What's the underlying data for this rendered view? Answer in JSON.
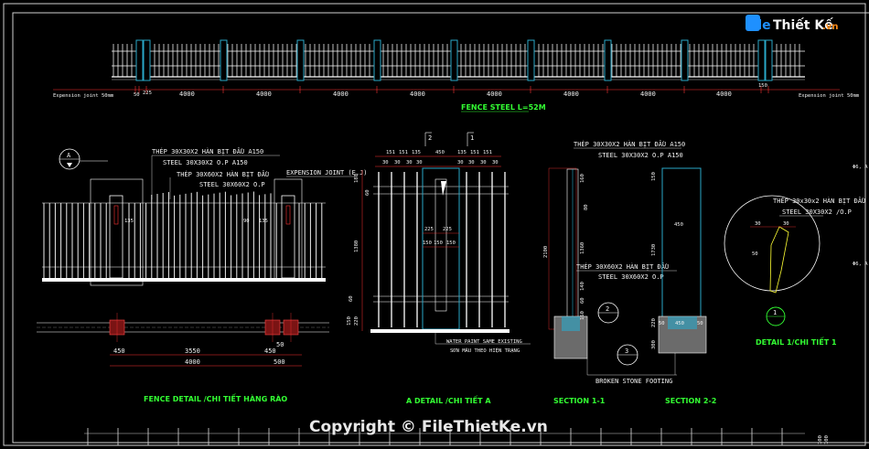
{
  "logo": {
    "part1": "File",
    "part2": "Thiết Kế",
    "part3": ".vn"
  },
  "watermark": "Copyright © FileThietKe.vn",
  "elevation": {
    "dims": [
      "4000",
      "4000",
      "4000",
      "4000",
      "4000",
      "4000",
      "4000",
      "4000",
      "4000"
    ],
    "joint_left": "Expension joint 50mm",
    "joint_right": "Expension joint 50mm",
    "small_dims": [
      "50",
      "225",
      "150"
    ],
    "title": "FENCE STEEL L=52M"
  },
  "fence_detail": {
    "callout": "A",
    "notes": [
      "THÉP 30X30X2 HÀN BỊT ĐẦU A150",
      "STEEL 30X30X2 O.P A150",
      "THÉP 30X60X2 HÀN BỊT ĐẦU",
      "STEEL 30X60X2 O.P"
    ],
    "expansion": "EXPENSION JOINT (E.J)",
    "dims_top": [
      "450",
      "3550",
      "450",
      "50"
    ],
    "dims_bottom": [
      "4000",
      "500"
    ],
    "small": [
      "135",
      "90",
      "135"
    ],
    "title": "FENCE DETAIL /CHI TIẾT HÀNG RÀO"
  },
  "detail_a": {
    "markers": [
      "2",
      "1"
    ],
    "dims_top": [
      "151",
      "151",
      "135",
      "450",
      "135",
      "151",
      "151"
    ],
    "dims_top2": [
      "30",
      "30",
      "30",
      "30",
      "30",
      "30",
      "30",
      "30"
    ],
    "dims_mid": [
      "225",
      "225"
    ],
    "dims_mid2": [
      "150",
      "150",
      "150"
    ],
    "vdims": [
      "180",
      "1380",
      "220",
      "150",
      "60",
      "60"
    ],
    "note1": "WATER PAINT SAME EXISTING",
    "note2": "SƠN MÀU THEO HIỆN TRẠNG",
    "title": "A DETAIL /CHI TIẾT A"
  },
  "sections": {
    "notes": [
      "THÉP 30X30X2 HÀN BỊT ĐẦU A150",
      "STEEL 30X30X2 O.P A150",
      "THÉP 30X60X2 HÀN BỊT ĐẦU",
      "STEEL 30X60X2 O.P"
    ],
    "dims_s1": [
      "160",
      "80",
      "1360",
      "2100",
      "140",
      "60",
      "160"
    ],
    "dims_s2": [
      "150",
      "450",
      "1730",
      "220",
      "300",
      "50",
      "450",
      "50"
    ],
    "markers": [
      "2",
      "3"
    ],
    "footing": "BROKEN STONE FOOTING",
    "title1": "SECTION 1-1",
    "title2": "SECTION 2-2"
  },
  "detail_1": {
    "notes": [
      "THÉP 30x30x2 HÀN BỊT ĐẦU",
      "STEEL 30X30X2 /O.P"
    ],
    "dims": [
      "30",
      "30",
      "50"
    ],
    "marker": "1",
    "title": "DETAIL 1/CHI TIẾT 1"
  },
  "edge": {
    "right_top": "Φ6, A",
    "right_bottom": "Φ6, A",
    "corner": [
      "100",
      "100"
    ]
  }
}
